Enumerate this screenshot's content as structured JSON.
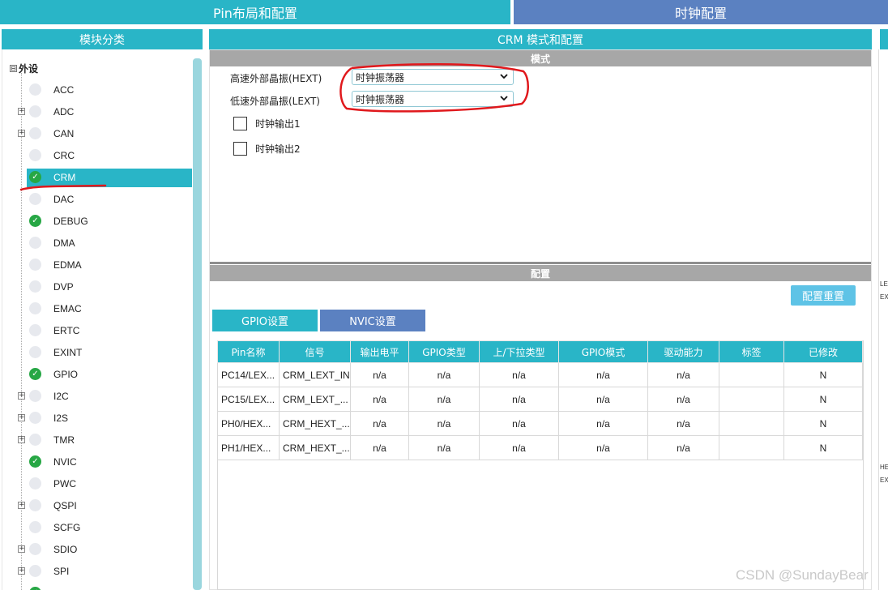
{
  "top_tabs": {
    "pin": "Pin布局和配置",
    "clock": "时钟配置"
  },
  "left": {
    "header": "模块分类",
    "root": {
      "expander": "⊟",
      "label": "外设"
    },
    "items": [
      {
        "name": "ACC",
        "expander": false,
        "status": "none",
        "selected": false
      },
      {
        "name": "ADC",
        "expander": true,
        "status": "none",
        "selected": false
      },
      {
        "name": "CAN",
        "expander": true,
        "status": "none",
        "selected": false
      },
      {
        "name": "CRC",
        "expander": false,
        "status": "none",
        "selected": false
      },
      {
        "name": "CRM",
        "expander": false,
        "status": "ok",
        "selected": true
      },
      {
        "name": "DAC",
        "expander": false,
        "status": "none",
        "selected": false
      },
      {
        "name": "DEBUG",
        "expander": false,
        "status": "ok",
        "selected": false
      },
      {
        "name": "DMA",
        "expander": false,
        "status": "none",
        "selected": false
      },
      {
        "name": "EDMA",
        "expander": false,
        "status": "none",
        "selected": false
      },
      {
        "name": "DVP",
        "expander": false,
        "status": "none",
        "selected": false
      },
      {
        "name": "EMAC",
        "expander": false,
        "status": "none",
        "selected": false
      },
      {
        "name": "ERTC",
        "expander": false,
        "status": "none",
        "selected": false
      },
      {
        "name": "EXINT",
        "expander": false,
        "status": "none",
        "selected": false
      },
      {
        "name": "GPIO",
        "expander": false,
        "status": "ok",
        "selected": false
      },
      {
        "name": "I2C",
        "expander": true,
        "status": "none",
        "selected": false
      },
      {
        "name": "I2S",
        "expander": true,
        "status": "none",
        "selected": false
      },
      {
        "name": "TMR",
        "expander": true,
        "status": "none",
        "selected": false
      },
      {
        "name": "NVIC",
        "expander": false,
        "status": "ok",
        "selected": false
      },
      {
        "name": "PWC",
        "expander": false,
        "status": "none",
        "selected": false
      },
      {
        "name": "QSPI",
        "expander": true,
        "status": "none",
        "selected": false
      },
      {
        "name": "SCFG",
        "expander": false,
        "status": "none",
        "selected": false
      },
      {
        "name": "SDIO",
        "expander": true,
        "status": "none",
        "selected": false
      },
      {
        "name": "SPI",
        "expander": true,
        "status": "none",
        "selected": false
      },
      {
        "name": "",
        "expander": false,
        "status": "ok",
        "selected": false
      }
    ]
  },
  "main": {
    "header": "CRM 模式和配置",
    "mode_bar": "模式",
    "hext": {
      "label": "高速外部晶振(HEXT)",
      "value": "时钟振荡器"
    },
    "lext": {
      "label": "低速外部晶振(LEXT)",
      "value": "时钟振荡器"
    },
    "clkout1": {
      "label": "时钟输出1",
      "checked": false
    },
    "clkout2": {
      "label": "时钟输出2",
      "checked": false
    },
    "config_bar": "配置",
    "reset_button": "配置重置",
    "tabs": {
      "gpio": "GPIO设置",
      "nvic": "NVIC设置"
    },
    "table": {
      "columns": [
        "Pin名称",
        "信号",
        "输出电平",
        "GPIO类型",
        "上/下拉类型",
        "GPIO模式",
        "驱动能力",
        "标签",
        "已修改"
      ],
      "rows": [
        [
          "PC14/LEX...",
          "CRM_LEXT_IN",
          "n/a",
          "n/a",
          "n/a",
          "n/a",
          "n/a",
          "",
          "N"
        ],
        [
          "PC15/LEX...",
          "CRM_LEXT_...",
          "n/a",
          "n/a",
          "n/a",
          "n/a",
          "n/a",
          "",
          "N"
        ],
        [
          "PH0/HEX...",
          "CRM_HEXT_...",
          "n/a",
          "n/a",
          "n/a",
          "n/a",
          "n/a",
          "",
          "N"
        ],
        [
          "PH1/HEX...",
          "CRM_HEXT_...",
          "n/a",
          "n/a",
          "n/a",
          "n/a",
          "n/a",
          "",
          "N"
        ]
      ]
    }
  },
  "edge_labels": [
    "LE",
    "EXT",
    "HE",
    "EXT"
  ],
  "watermark": "CSDN @SundayBear",
  "colors": {
    "teal": "#29b5c7",
    "blue": "#5b81c1",
    "green": "#27a745",
    "annotation_red": "#e0181c"
  }
}
